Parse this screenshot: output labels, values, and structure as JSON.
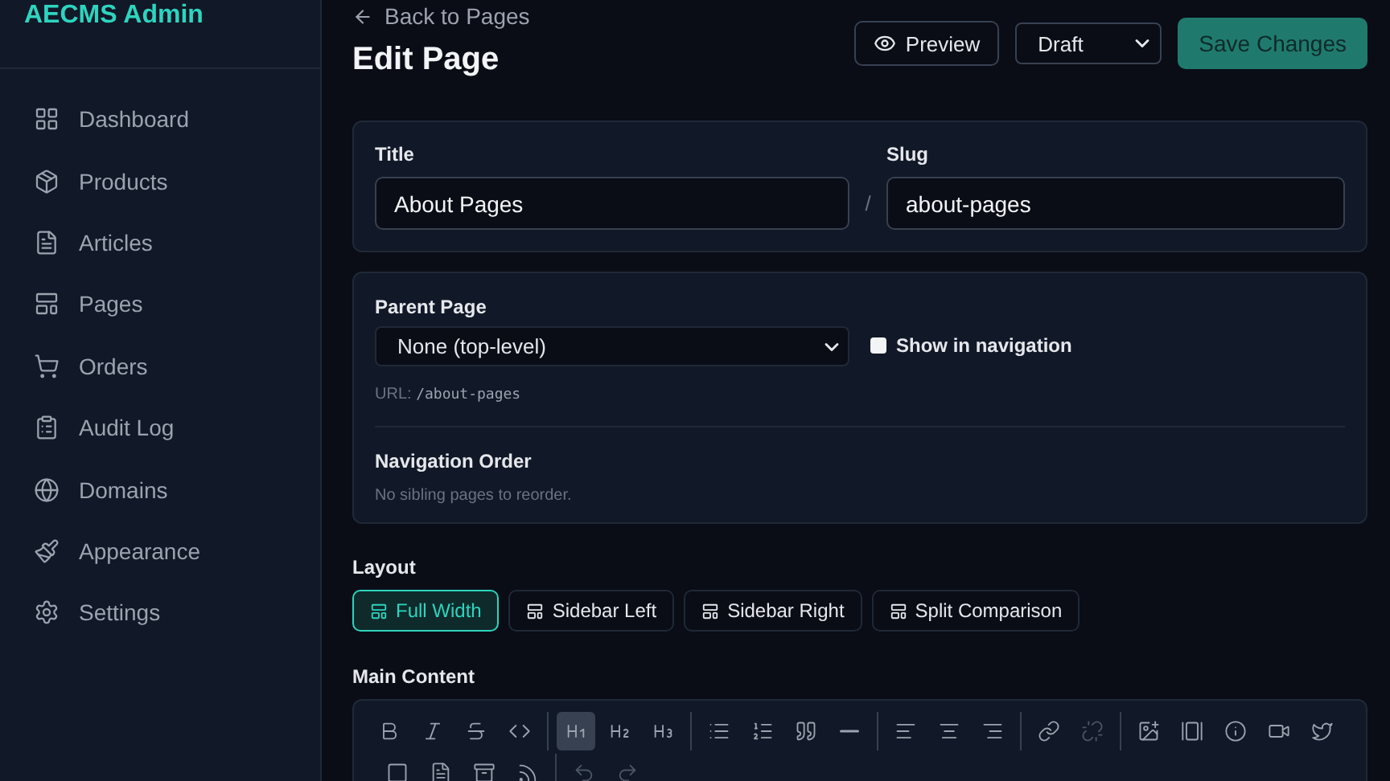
{
  "sidebar": {
    "brand": "AECMS Admin",
    "items": [
      {
        "label": "Dashboard"
      },
      {
        "label": "Products"
      },
      {
        "label": "Articles"
      },
      {
        "label": "Pages"
      },
      {
        "label": "Orders"
      },
      {
        "label": "Audit Log"
      },
      {
        "label": "Domains"
      },
      {
        "label": "Appearance"
      },
      {
        "label": "Settings"
      }
    ]
  },
  "header": {
    "back_link": "Back to Pages",
    "title": "Edit Page",
    "preview_button": "Preview",
    "status_select": "Draft",
    "save_button": "Save Changes"
  },
  "basics": {
    "title_label": "Title",
    "title_value": "About Pages",
    "slug_separator": "/",
    "slug_label": "Slug",
    "slug_value": "about-pages"
  },
  "hierarchy": {
    "parent_label": "Parent Page",
    "parent_value": "None (top-level)",
    "show_in_navigation": {
      "label": "Show in navigation",
      "checked": false
    },
    "url_label": "URL:",
    "url_value": "/about-pages",
    "order_label": "Navigation Order",
    "order_hint": "No sibling pages to reorder."
  },
  "layout": {
    "label": "Layout",
    "options": [
      {
        "label": "Full Width",
        "selected": true
      },
      {
        "label": "Sidebar Left",
        "selected": false
      },
      {
        "label": "Sidebar Right",
        "selected": false
      },
      {
        "label": "Split Comparison",
        "selected": false
      }
    ]
  },
  "editor": {
    "label": "Main Content",
    "toolbar": [
      [
        {
          "kind": "bold",
          "active": false
        },
        {
          "kind": "italic",
          "active": false
        },
        {
          "kind": "strike",
          "active": false
        },
        {
          "kind": "code",
          "active": false
        }
      ],
      [
        {
          "kind": "h1",
          "active": true
        },
        {
          "kind": "h2",
          "active": false
        },
        {
          "kind": "h3",
          "active": false
        }
      ],
      [
        {
          "kind": "bullets",
          "active": false
        },
        {
          "kind": "numbers",
          "active": false
        },
        {
          "kind": "quote",
          "active": false
        },
        {
          "kind": "rule",
          "active": false
        }
      ],
      [
        {
          "kind": "align-left",
          "active": false
        },
        {
          "kind": "align-center",
          "active": false
        },
        {
          "kind": "align-right",
          "active": false
        }
      ],
      [
        {
          "kind": "link",
          "active": false
        },
        {
          "kind": "unlink",
          "active": false
        }
      ],
      [
        {
          "kind": "image",
          "active": false
        },
        {
          "kind": "gallery",
          "active": false
        },
        {
          "kind": "info",
          "active": false
        },
        {
          "kind": "video",
          "active": false
        },
        {
          "kind": "twitter",
          "active": false
        }
      ],
      [
        {
          "kind": "square",
          "active": false
        },
        {
          "kind": "file",
          "active": false
        },
        {
          "kind": "archive",
          "active": false
        },
        {
          "kind": "rss",
          "active": false
        }
      ],
      [
        {
          "kind": "undo",
          "active": false
        },
        {
          "kind": "redo",
          "active": false
        }
      ]
    ]
  }
}
